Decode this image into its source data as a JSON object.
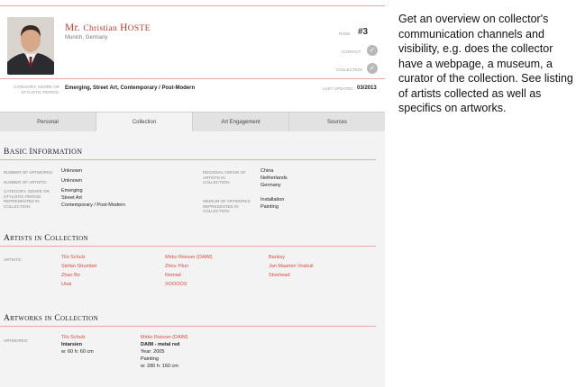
{
  "profile": {
    "name_first": "Mr. ",
    "name_first_rest": "Christian",
    "name_last_initial": "H",
    "name_last_rest": "OSTE",
    "location": "Munich, Germany",
    "rank_label": "RANK",
    "rank_value": "#3",
    "contact_label": "CONTACT",
    "collection_label": "COLLECTION",
    "category_label": "CATEGORY, GENRE OR STYLISTIC PERIOD:",
    "category_value": "Emerging, Street Art, Contemporary / Post-Modern",
    "last_updated_label": "LAST UPDATED:",
    "last_updated_value": "03/2013"
  },
  "tabs": [
    "Personal",
    "Collection",
    "Art Engagement",
    "Sources"
  ],
  "basic_info": {
    "title_initial": "B",
    "title_rest": "ASIC ",
    "title_initial2": "I",
    "title_rest2": "NFORMATION",
    "num_artworks_label": "NUMBER OF ARTWORKS:",
    "num_artworks_value": "Unknown",
    "num_artists_label": "NUMBER OF ARTISTS:",
    "num_artists_value": "Unknown",
    "category_label": "CATEGORY, GENRE OR STYLISTIC PERIOD REPRESENTED IN COLLECTION:",
    "category_values": [
      "Emerging",
      "Street Art",
      "Contemporary / Post-Modern"
    ],
    "origin_label": "REGIONAL ORIGIN OF ARTISTS IN COLLECTION:",
    "origin_values": [
      "China",
      "Netherlands",
      "Germany"
    ],
    "medium_label": "MEDIUM OF ARTWORKS REPRESENTED IN COLLECTION:",
    "medium_values": [
      "Installation",
      "Painting"
    ]
  },
  "artists": {
    "title": "Artists in Collection",
    "label": "ARTISTS:",
    "col1": [
      "Tilo Schulz",
      "Stefan Strumbel",
      "Zhao Bo",
      "Unai"
    ],
    "col2": [
      "Mirko Reisser (DAIM)",
      "Zhou Yilun",
      "Nomad",
      "XOOOOX"
    ],
    "col3": [
      "Banksy",
      "Jan Maarten Voskuil",
      "Stoehead"
    ]
  },
  "artworks": {
    "title": "Artworks in Collection",
    "label": "ARTWORKS:",
    "items": [
      {
        "artist": "Tilo Schulz",
        "title": "Intarsien",
        "details": [
          "w: 60 h: 60 cm"
        ]
      },
      {
        "artist": "Mirko Reisser (DAIM)",
        "title": "DAIM - metal red",
        "details": [
          "Year: 2005",
          "Painting",
          "w: 280 h: 160 cm"
        ]
      }
    ]
  },
  "description": "Get an overview on collector's communication channels and visibility, e.g. does the collector have a webpage, a museum, a curator of the collection.  See listing of artists collected as well as specifics on artworks."
}
